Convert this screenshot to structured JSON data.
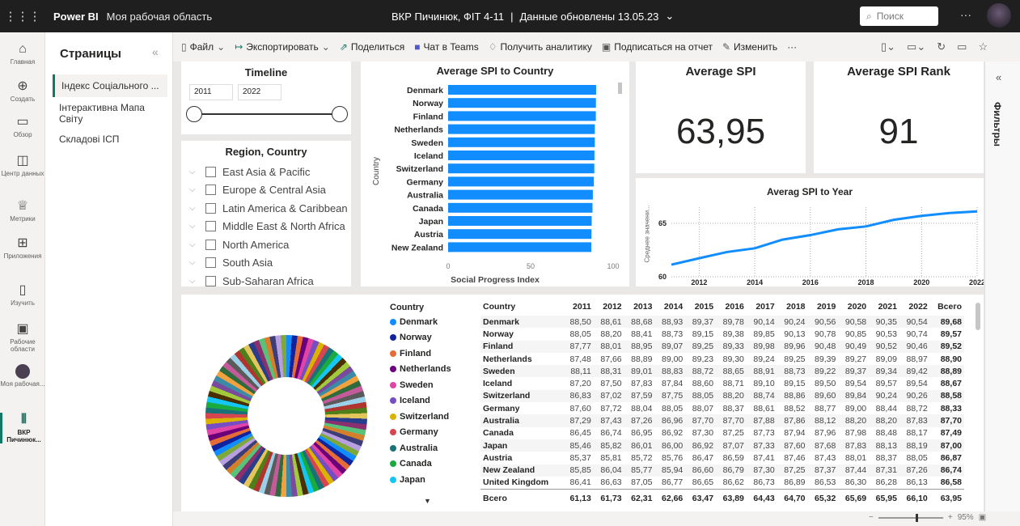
{
  "topbar": {
    "brand": "Power BI",
    "workspace": "Моя рабочая область",
    "report_title": "ВКР Пичинюк, ФІТ 4-11",
    "separator": "|",
    "updated": "Данные обновлены 13.05.23",
    "search_placeholder": "Поиск"
  },
  "leftnav": [
    {
      "label": "Главная",
      "icon": "home-icon"
    },
    {
      "label": "Создать",
      "icon": "plus-icon"
    },
    {
      "label": "Обзор",
      "icon": "folder-icon"
    },
    {
      "label": "Центр данных",
      "icon": "data-hub-icon"
    },
    {
      "label": "Метрики",
      "icon": "trophy-icon"
    },
    {
      "label": "Приложения",
      "icon": "apps-icon"
    },
    {
      "label": "Изучить",
      "icon": "book-icon"
    },
    {
      "label": "Рабочие области",
      "icon": "workspaces-icon"
    },
    {
      "label": "Моя рабочая...",
      "icon": "avatar-icon"
    },
    {
      "label": "ВКР Пичинюк...",
      "icon": "report-icon"
    }
  ],
  "pages": {
    "title": "Страницы",
    "items": [
      "Індекс Соціального ...",
      "Інтерактивна Мапа Світу",
      "Складові ІСП"
    ]
  },
  "toolbar": {
    "file": "Файл",
    "export": "Экспортировать",
    "share": "Поделиться",
    "teams": "Чат в Teams",
    "insights": "Получить аналитику",
    "subscribe": "Подписаться на отчет",
    "edit": "Изменить",
    "more": "···"
  },
  "timeline": {
    "title": "Timeline",
    "start": "2011",
    "end": "2022"
  },
  "region": {
    "title": "Region, Country",
    "items": [
      "East Asia & Pacific",
      "Europe & Central Asia",
      "Latin America & Caribbean",
      "Middle East & North Africa",
      "North America",
      "South Asia",
      "Sub-Saharan Africa"
    ]
  },
  "bar_chart": {
    "title": "Average SPI to Country",
    "ylabel": "Country",
    "xlabel": "Social Progress Index",
    "ticks": [
      "0",
      "50",
      "100"
    ]
  },
  "kpi": {
    "avg_spi_title": "Average SPI",
    "avg_spi_value": "63,95",
    "avg_rank_title": "Average SPI Rank",
    "avg_rank_value": "91"
  },
  "line_chart": {
    "title": "Averag SPI to Year",
    "ylabel": "Среднее значени...",
    "y_ticks": [
      "65",
      "60"
    ],
    "x_ticks": [
      "2012",
      "2014",
      "2016",
      "2018",
      "2020",
      "2022"
    ]
  },
  "legend": {
    "title": "Country",
    "items": [
      {
        "name": "Denmark",
        "color": "#118dff"
      },
      {
        "name": "Norway",
        "color": "#12239e"
      },
      {
        "name": "Finland",
        "color": "#e66c37"
      },
      {
        "name": "Netherlands",
        "color": "#6b007b"
      },
      {
        "name": "Sweden",
        "color": "#e044a7"
      },
      {
        "name": "Iceland",
        "color": "#744ec2"
      },
      {
        "name": "Switzerland",
        "color": "#d9b300"
      },
      {
        "name": "Germany",
        "color": "#d64550"
      },
      {
        "name": "Australia",
        "color": "#197278"
      },
      {
        "name": "Canada",
        "color": "#1aab40"
      },
      {
        "name": "Japan",
        "color": "#15c6f4"
      }
    ]
  },
  "table": {
    "headers": [
      "Country",
      "2011",
      "2012",
      "2013",
      "2014",
      "2015",
      "2016",
      "2017",
      "2018",
      "2019",
      "2020",
      "2021",
      "2022",
      "Всего"
    ],
    "rows": [
      [
        "Denmark",
        "88,50",
        "88,61",
        "88,68",
        "88,93",
        "89,37",
        "89,78",
        "90,14",
        "90,24",
        "90,56",
        "90,58",
        "90,35",
        "90,54",
        "89,68"
      ],
      [
        "Norway",
        "88,05",
        "88,20",
        "88,41",
        "88,73",
        "89,15",
        "89,38",
        "89,85",
        "90,13",
        "90,78",
        "90,85",
        "90,53",
        "90,74",
        "89,57"
      ],
      [
        "Finland",
        "87,77",
        "88,01",
        "88,95",
        "89,07",
        "89,25",
        "89,33",
        "89,98",
        "89,96",
        "90,48",
        "90,49",
        "90,52",
        "90,46",
        "89,52"
      ],
      [
        "Netherlands",
        "87,48",
        "87,66",
        "88,89",
        "89,00",
        "89,23",
        "89,30",
        "89,24",
        "89,25",
        "89,39",
        "89,27",
        "89,09",
        "88,97",
        "88,90"
      ],
      [
        "Sweden",
        "88,11",
        "88,31",
        "89,01",
        "88,83",
        "88,72",
        "88,65",
        "88,91",
        "88,73",
        "89,22",
        "89,37",
        "89,34",
        "89,42",
        "88,89"
      ],
      [
        "Iceland",
        "87,20",
        "87,50",
        "87,83",
        "87,84",
        "88,60",
        "88,71",
        "89,10",
        "89,15",
        "89,50",
        "89,54",
        "89,57",
        "89,54",
        "88,67"
      ],
      [
        "Switzerland",
        "86,83",
        "87,02",
        "87,59",
        "87,75",
        "88,05",
        "88,20",
        "88,74",
        "88,86",
        "89,60",
        "89,84",
        "90,24",
        "90,26",
        "88,58"
      ],
      [
        "Germany",
        "87,60",
        "87,72",
        "88,04",
        "88,05",
        "88,07",
        "88,37",
        "88,61",
        "88,52",
        "88,77",
        "89,00",
        "88,44",
        "88,72",
        "88,33"
      ],
      [
        "Australia",
        "87,29",
        "87,43",
        "87,26",
        "86,96",
        "87,70",
        "87,70",
        "87,88",
        "87,86",
        "88,12",
        "88,20",
        "88,20",
        "87,83",
        "87,70"
      ],
      [
        "Canada",
        "86,45",
        "86,74",
        "86,95",
        "86,92",
        "87,30",
        "87,25",
        "87,73",
        "87,94",
        "87,96",
        "87,98",
        "88,48",
        "88,17",
        "87,49"
      ],
      [
        "Japan",
        "85,46",
        "85,82",
        "86,01",
        "86,00",
        "86,92",
        "87,07",
        "87,33",
        "87,60",
        "87,68",
        "87,83",
        "88,13",
        "88,19",
        "87,00"
      ],
      [
        "Austria",
        "85,37",
        "85,81",
        "85,72",
        "85,76",
        "86,47",
        "86,59",
        "87,41",
        "87,46",
        "87,43",
        "88,01",
        "88,37",
        "88,05",
        "86,87"
      ],
      [
        "New Zealand",
        "85,85",
        "86,04",
        "85,77",
        "85,94",
        "86,60",
        "86,79",
        "87,30",
        "87,25",
        "87,37",
        "87,44",
        "87,31",
        "87,26",
        "86,74"
      ],
      [
        "United Kingdom",
        "86,41",
        "86,63",
        "87,05",
        "86,77",
        "86,65",
        "86,62",
        "86,73",
        "86,89",
        "86,53",
        "86,30",
        "86,28",
        "86,13",
        "86,58"
      ]
    ],
    "total": [
      "Всего",
      "61,13",
      "61,73",
      "62,31",
      "62,66",
      "63,47",
      "63,89",
      "64,43",
      "64,70",
      "65,32",
      "65,69",
      "65,95",
      "66,10",
      "63,95"
    ]
  },
  "filters_label": "Фильтры",
  "zoom": "95%",
  "chart_data": [
    {
      "type": "bar",
      "title": "Average SPI to Country",
      "ylabel": "Country",
      "xlabel": "Social Progress Index",
      "categories": [
        "Denmark",
        "Norway",
        "Finland",
        "Netherlands",
        "Sweden",
        "Iceland",
        "Switzerland",
        "Germany",
        "Australia",
        "Canada",
        "Japan",
        "Austria",
        "New Zealand"
      ],
      "values": [
        89.68,
        89.57,
        89.52,
        88.9,
        88.89,
        88.67,
        88.58,
        88.33,
        87.7,
        87.49,
        87.0,
        86.87,
        86.74
      ],
      "xlim": [
        0,
        100
      ],
      "color": "#118dff"
    },
    {
      "type": "line",
      "title": "Averag SPI to Year",
      "ylabel": "Среднее значени...",
      "x": [
        2011,
        2012,
        2013,
        2014,
        2015,
        2016,
        2017,
        2018,
        2019,
        2020,
        2021,
        2022
      ],
      "y": [
        61.13,
        61.73,
        62.31,
        62.66,
        63.47,
        63.89,
        64.43,
        64.7,
        65.32,
        65.69,
        65.95,
        66.1
      ],
      "ylim": [
        60,
        66.5
      ],
      "color": "#118dff"
    }
  ]
}
